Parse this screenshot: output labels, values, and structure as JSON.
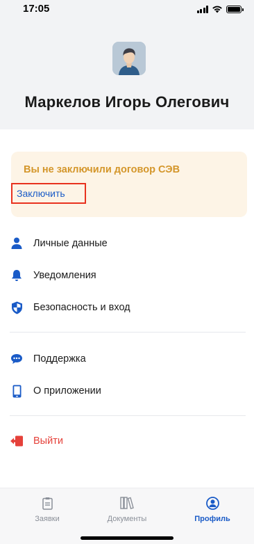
{
  "status_bar": {
    "time": "17:05"
  },
  "profile": {
    "name": "Маркелов Игорь Олегович"
  },
  "banner": {
    "title": "Вы не заключили договор СЭВ",
    "action_label": "Заключить"
  },
  "menu": {
    "personal": "Личные данные",
    "notifications": "Уведомления",
    "security": "Безопасность и вход",
    "support": "Поддержка",
    "about": "О приложении",
    "logout": "Выйти"
  },
  "tabs": [
    {
      "label": "Заявки",
      "icon": "clipboard-icon"
    },
    {
      "label": "Документы",
      "icon": "books-icon"
    },
    {
      "label": "Профиль",
      "icon": "profile-icon"
    }
  ],
  "colors": {
    "accent": "#1a5bc7",
    "warning_text": "#d4962a",
    "warning_bg": "#fdf4e6",
    "danger": "#e5413a",
    "highlight_border": "#e8321e"
  }
}
